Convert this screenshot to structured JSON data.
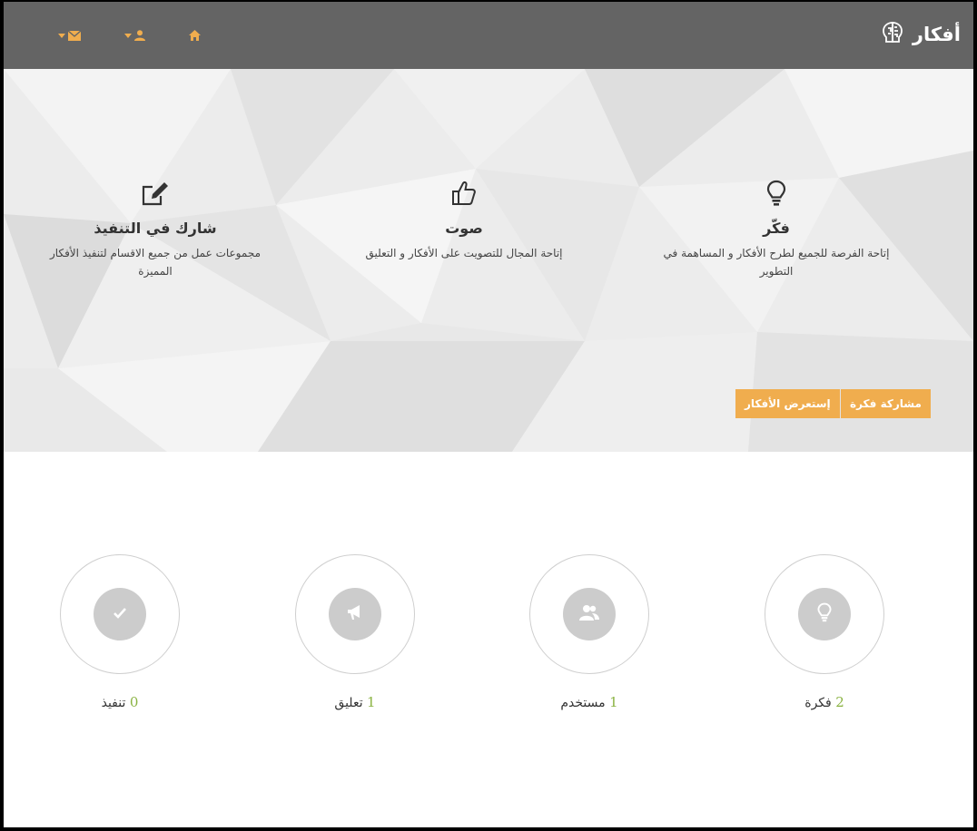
{
  "header": {
    "brand_name": "أفكار",
    "brand_icon": "brain-icon",
    "nav": [
      {
        "icon": "home-icon"
      },
      {
        "icon": "user-icon",
        "dropdown": true
      },
      {
        "icon": "envelope-icon",
        "dropdown": true
      }
    ]
  },
  "hero": {
    "features": [
      {
        "icon": "lightbulb-icon",
        "title": "فكّر",
        "text_line1": "إتاحة الفرصة للجميع لطرح الأفكار و المساهمة في",
        "text_line2": "التطوير"
      },
      {
        "icon": "thumbs-up-icon",
        "title": "صوت",
        "text_line1": "إتاحة المجال للتصويت على الأفكار و التعليق",
        "text_line2": ""
      },
      {
        "icon": "edit-icon",
        "title": "شارك في التنفيذ",
        "text_line1": "مجموعات عمل من جميع الاقسام لتنفيذ الأفكار",
        "text_line2": "المميزة"
      }
    ],
    "share_button": "مشاركة فكرة",
    "browse_button": "إستعرض الأفكار"
  },
  "stats": [
    {
      "icon": "lightbulb-icon",
      "value": "2",
      "label": "فكرة"
    },
    {
      "icon": "users-icon",
      "value": "1",
      "label": "مستخدم"
    },
    {
      "icon": "bullhorn-icon",
      "value": "1",
      "label": "تعليق"
    },
    {
      "icon": "check-icon",
      "value": "0",
      "label": "تنفيذ"
    }
  ],
  "colors": {
    "topbar": "#646464",
    "accent": "#f0ad4e",
    "stat_number": "#8ab342",
    "stat_icon_bg": "#cccccc"
  }
}
